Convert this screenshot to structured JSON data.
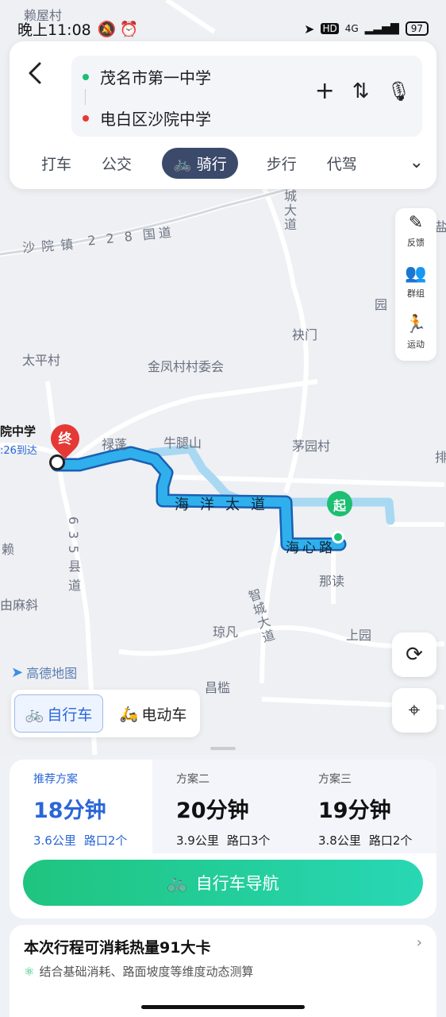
{
  "status_bar": {
    "time": "晚上11:08",
    "battery": "97",
    "net": "4G"
  },
  "route": {
    "start": "茂名市第一中学",
    "end": "电白区沙院中学",
    "start_color": "#1dbf73",
    "end_color": "#e53935"
  },
  "modes": [
    "打车",
    "公交",
    "骑行",
    "步行",
    "代驾"
  ],
  "active_mode": "骑行",
  "right_tools": [
    {
      "label": "反馈",
      "icon": "pencil-icon"
    },
    {
      "label": "群组",
      "icon": "group-icon"
    },
    {
      "label": "运动",
      "icon": "sport-icon"
    }
  ],
  "map": {
    "labels": {
      "laiwu": "赖屋村",
      "shayuan": "沙院镇",
      "taiping": "太平村",
      "jinfeng": "金凤村村委会",
      "luopeng": "禄蓬",
      "niutui": "牛腿山",
      "maoyuan": "茅园村",
      "naidu": "那读",
      "jiumen": "袂门",
      "youmaxie": "由麻斜",
      "qiongfan": "琼凡",
      "shangyuan": "上园",
      "changkan": "昌槛",
      "lai": "赖",
      "yuan": "园",
      "pai": "排",
      "yan": "盐"
    },
    "roads": {
      "g228": "2 2 8 国道",
      "haiyang": "海洋太道",
      "haixin": "海心路",
      "chengda": "城大道",
      "zhicheng": "智城大道",
      "x635": "635县道"
    },
    "end_pin": "终",
    "start_pin": "起",
    "end_name": "院中学",
    "end_eta": ":26到达",
    "logo": "高德地图"
  },
  "vehicle": {
    "bike": "自行车",
    "ebike": "电动车"
  },
  "plans": [
    {
      "name": "推荐方案",
      "time": "18分钟",
      "distance": "3.6公里",
      "junctions": "路口2个"
    },
    {
      "name": "方案二",
      "time": "20分钟",
      "distance": "3.9公里",
      "junctions": "路口3个"
    },
    {
      "name": "方案三",
      "time": "19分钟",
      "distance": "3.8公里",
      "junctions": "路口2个"
    }
  ],
  "nav_button": "自行车导航",
  "calorie": {
    "title": "本次行程可消耗热量91大卡",
    "subtitle": "结合基础消耗、路面坡度等维度动态测算"
  }
}
